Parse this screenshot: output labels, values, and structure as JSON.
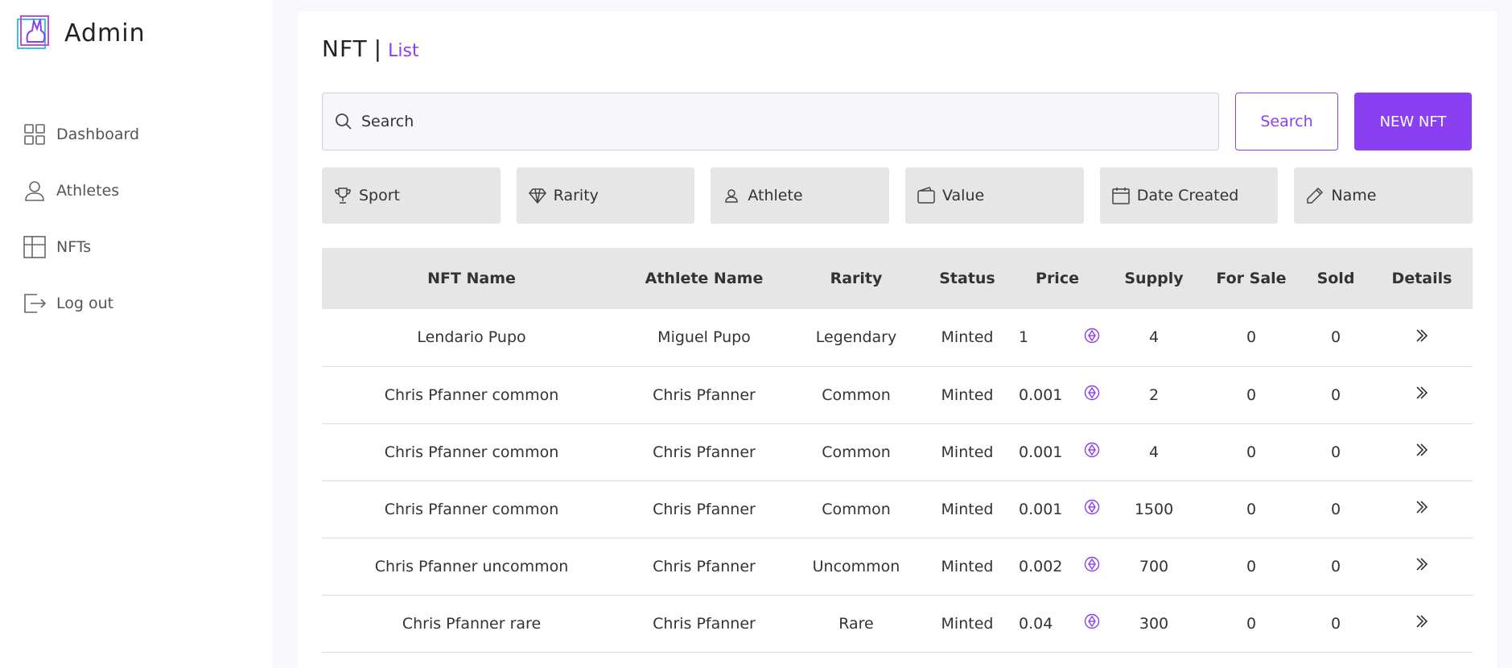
{
  "app": {
    "title": "Admin"
  },
  "sidebar": {
    "items": [
      {
        "label": "Dashboard",
        "icon": "grid-icon"
      },
      {
        "label": "Athletes",
        "icon": "user-icon"
      },
      {
        "label": "NFTs",
        "icon": "layout-icon"
      },
      {
        "label": "Log out",
        "icon": "logout-icon"
      }
    ]
  },
  "page": {
    "title": "NFT",
    "separator": "|",
    "subtitle": "List"
  },
  "search": {
    "placeholder": "Search",
    "button_label": "Search"
  },
  "new_button_label": "NEW NFT",
  "filters": [
    {
      "label": "Sport",
      "icon": "trophy-icon"
    },
    {
      "label": "Rarity",
      "icon": "diamond-icon"
    },
    {
      "label": "Athlete",
      "icon": "person-icon"
    },
    {
      "label": "Value",
      "icon": "wallet-icon"
    },
    {
      "label": "Date Created",
      "icon": "calendar-icon"
    },
    {
      "label": "Name",
      "icon": "pencil-icon"
    }
  ],
  "table": {
    "headers": [
      "NFT Name",
      "Athlete Name",
      "Rarity",
      "Status",
      "Price",
      "",
      "Supply",
      "For Sale",
      "Sold",
      "Details"
    ],
    "rows": [
      {
        "nft_name": "Lendario Pupo",
        "athlete": "Miguel Pupo",
        "rarity": "Legendary",
        "status": "Minted",
        "price": "1",
        "supply": "4",
        "for_sale": "0",
        "sold": "0"
      },
      {
        "nft_name": "Chris Pfanner common",
        "athlete": "Chris Pfanner",
        "rarity": "Common",
        "status": "Minted",
        "price": "0.001",
        "supply": "2",
        "for_sale": "0",
        "sold": "0"
      },
      {
        "nft_name": "Chris Pfanner common",
        "athlete": "Chris Pfanner",
        "rarity": "Common",
        "status": "Minted",
        "price": "0.001",
        "supply": "4",
        "for_sale": "0",
        "sold": "0"
      },
      {
        "nft_name": "Chris Pfanner common",
        "athlete": "Chris Pfanner",
        "rarity": "Common",
        "status": "Minted",
        "price": "0.001",
        "supply": "1500",
        "for_sale": "0",
        "sold": "0"
      },
      {
        "nft_name": "Chris Pfanner uncommon",
        "athlete": "Chris Pfanner",
        "rarity": "Uncommon",
        "status": "Minted",
        "price": "0.002",
        "supply": "700",
        "for_sale": "0",
        "sold": "0"
      },
      {
        "nft_name": "Chris Pfanner rare",
        "athlete": "Chris Pfanner",
        "rarity": "Rare",
        "status": "Minted",
        "price": "0.04",
        "supply": "300",
        "for_sale": "0",
        "sold": "0"
      }
    ]
  },
  "colors": {
    "accent": "#8b3ff2",
    "status_minted": "#14a39a",
    "filter_bg": "#e6e6e6"
  }
}
